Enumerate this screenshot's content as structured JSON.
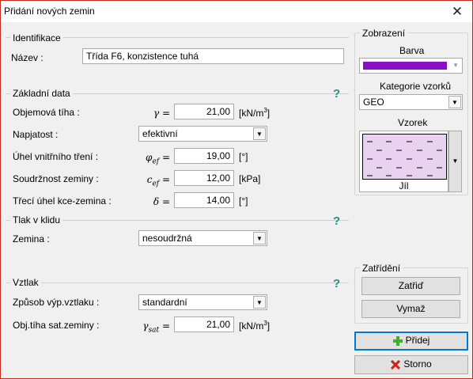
{
  "window": {
    "title": "Přidání nových zemin",
    "close_glyph": "✕"
  },
  "identification": {
    "group_title": "Identifikace",
    "name_label": "Název :",
    "name_value": "Třída F6, konzistence tuhá"
  },
  "basic": {
    "group_title": "Základní data",
    "help": "?",
    "unit_weight": {
      "label": "Objemová tíha :",
      "symbol": "γ =",
      "value": "21,00",
      "unit": "[kN/m",
      "unit_sup": "3",
      "unit_end": "]"
    },
    "stress": {
      "label": "Napjatost :",
      "value": "efektivní"
    },
    "friction": {
      "label": "Úhel vnitřního tření :",
      "symbol": "φ",
      "symbol_sub": "ef",
      "symbol_eq": " =",
      "value": "19,00",
      "unit": "[°]"
    },
    "cohesion": {
      "label": "Soudržnost zeminy :",
      "symbol": "c",
      "symbol_sub": "ef",
      "symbol_eq": " =",
      "value": "12,00",
      "unit": "[kPa]"
    },
    "structure_friction": {
      "label": "Třecí úhel kce-zemina :",
      "symbol": "δ =",
      "value": "14,00",
      "unit": "[°]"
    }
  },
  "rest_pressure": {
    "group_title": "Tlak v klidu",
    "help": "?",
    "soil_label": "Zemina :",
    "soil_value": "nesoudržná"
  },
  "uplift": {
    "group_title": "Vztlak",
    "help": "?",
    "method_label": "Způsob výp.vztlaku :",
    "method_value": "standardní",
    "sat_label": "Obj.tíha sat.zeminy :",
    "sat_symbol": "γ",
    "sat_symbol_sub": "sat",
    "sat_symbol_eq": " =",
    "sat_value": "21,00",
    "sat_unit": "[kN/m",
    "sat_unit_sup": "3",
    "sat_unit_end": "]"
  },
  "display": {
    "group_title": "Zobrazení",
    "color_label": "Barva",
    "color_value": "#8a0fc2",
    "category_label": "Kategorie vzorků",
    "category_value": "GEO",
    "pattern_label": "Vzorek",
    "pattern_name": "Jíl",
    "pattern_color": "#e9d2f0"
  },
  "classification": {
    "group_title": "Zatřídění",
    "classify_button": "Zatřiď",
    "delete_button": "Vymaž"
  },
  "actions": {
    "add_button": "Přidej",
    "cancel_button": "Storno"
  }
}
